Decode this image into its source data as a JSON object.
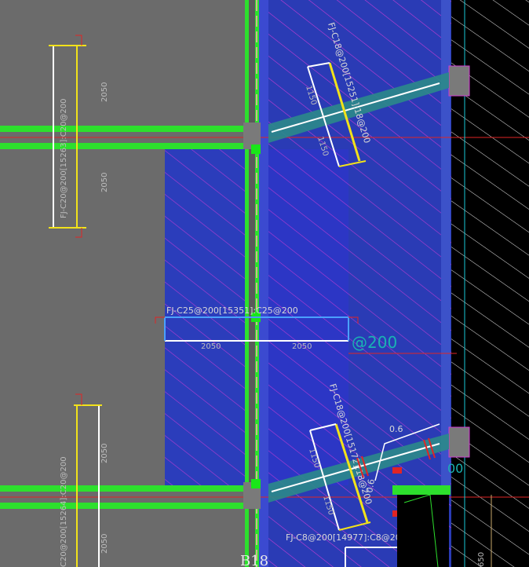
{
  "drawing": {
    "axis_label": "B18",
    "colors": {
      "background": "#000000",
      "slab_gray": "#6b6b6b",
      "wall_green": "#2de02d",
      "zone_blue": "#2b3dbb",
      "hatch_magenta": "#c43bd4",
      "rebar_white": "#ffffff",
      "rebar_yellow": "#f2e21a",
      "red_line": "#e02525",
      "cyan_text": "#16a9a9",
      "gridline_cyan": "#18c9d6"
    }
  },
  "labels": {
    "rebar_top_diag": "FJ-C18@200[15251]:18@200",
    "dim_top_diag_a": "1150",
    "dim_top_diag_b": "1150",
    "rebar_left_top": "FJ-C20@200[15263]:C20@200",
    "dim_left_top_a": "2050",
    "dim_left_top_b": "2050",
    "rebar_center": "FJ-C25@200[15351]:C25@200",
    "dim_center_left": "2050",
    "dim_center_right": "2050",
    "cyan_center": "@200",
    "rebar_bottom_diag": "FJ-C18@200[15172]:18@200",
    "dim_bottom_diag_a": "1150",
    "dim_bottom_diag_b": "1150",
    "slope_1": "0.6",
    "slope_2": "0.6",
    "rebar_left_bottom": "C20@200[15264]:C20@200",
    "dim_left_bottom_a": "2050",
    "dim_left_bottom_b": "2050",
    "rebar_bottom": "FJ-C8@200[14977]:C8@200",
    "dim_right_bottom": "650",
    "cyan_right_bottom": "00"
  }
}
